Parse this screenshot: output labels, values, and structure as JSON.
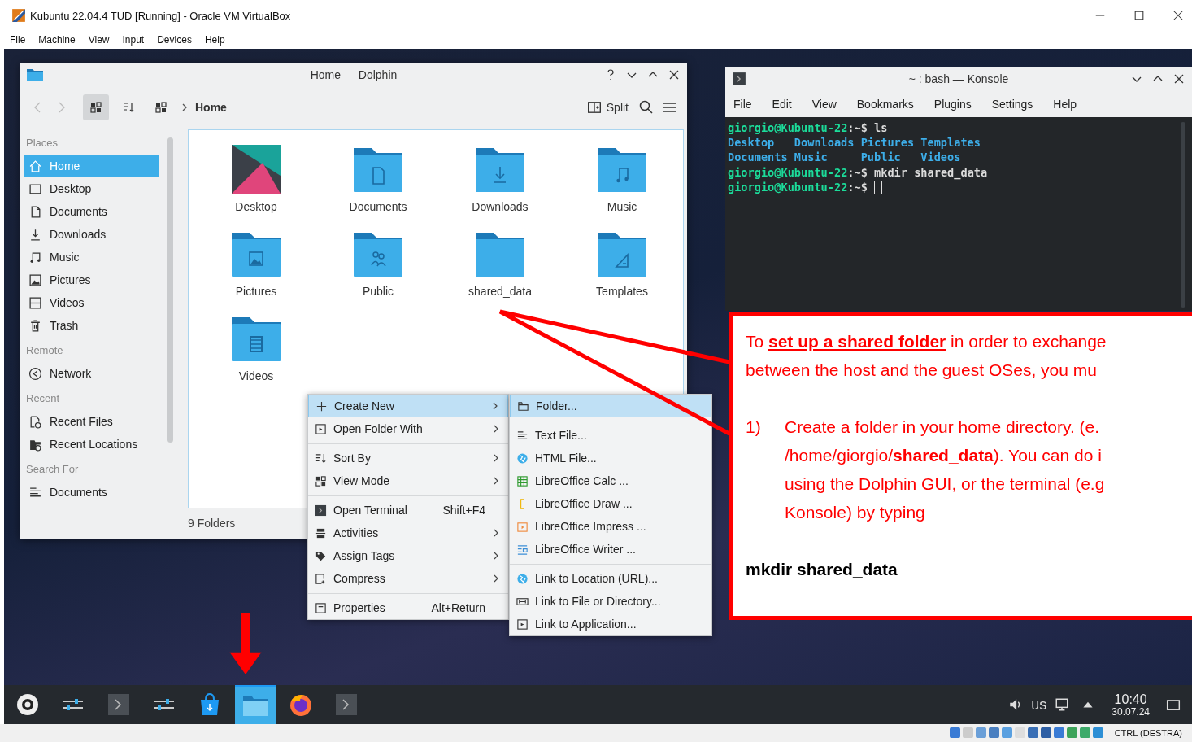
{
  "vbox": {
    "title": "Kubuntu 22.04.4 TUD [Running] - Oracle VM VirtualBox",
    "menu": [
      "File",
      "Machine",
      "View",
      "Input",
      "Devices",
      "Help"
    ]
  },
  "dolphin": {
    "title": "Home — Dolphin",
    "view_modes": [
      {
        "selected": true
      },
      {
        "selected": false
      },
      {
        "selected": false
      }
    ],
    "breadcrumb": "Home",
    "split_label": "Split",
    "places": [
      {
        "heading": "Places",
        "items": [
          {
            "label": "Home",
            "selected": true
          },
          {
            "label": "Desktop",
            "selected": false
          },
          {
            "label": "Documents",
            "selected": false
          },
          {
            "label": "Downloads",
            "selected": false
          },
          {
            "label": "Music",
            "selected": false
          },
          {
            "label": "Pictures",
            "selected": false
          },
          {
            "label": "Videos",
            "selected": false
          },
          {
            "label": "Trash",
            "selected": false
          }
        ]
      },
      {
        "heading": "Remote",
        "items": [
          {
            "label": "Network",
            "selected": false
          }
        ]
      },
      {
        "heading": "Recent",
        "items": [
          {
            "label": "Recent Files",
            "selected": false
          },
          {
            "label": "Recent Locations",
            "selected": false
          }
        ]
      },
      {
        "heading": "Search For",
        "items": [
          {
            "label": "Documents",
            "selected": false
          }
        ]
      }
    ],
    "files": [
      {
        "name": "Desktop",
        "kind": "desktop"
      },
      {
        "name": "Documents",
        "kind": "documents"
      },
      {
        "name": "Downloads",
        "kind": "downloads"
      },
      {
        "name": "Music",
        "kind": "music"
      },
      {
        "name": "Pictures",
        "kind": "pictures"
      },
      {
        "name": "Public",
        "kind": "public"
      },
      {
        "name": "shared_data",
        "kind": "plain"
      },
      {
        "name": "Templates",
        "kind": "templates"
      },
      {
        "name": "Videos",
        "kind": "videos"
      }
    ],
    "status": "9 Folders"
  },
  "context_menu": {
    "items": [
      {
        "kind": "item",
        "label": "Create New",
        "submenu": true,
        "selected": true
      },
      {
        "kind": "item",
        "label": "Open Folder With",
        "submenu": true,
        "selected": false
      },
      {
        "kind": "separator"
      },
      {
        "kind": "item",
        "label": "Sort By",
        "submenu": true,
        "selected": false
      },
      {
        "kind": "item",
        "label": "View Mode",
        "submenu": true,
        "selected": false
      },
      {
        "kind": "separator"
      },
      {
        "kind": "item",
        "label": "Open Terminal",
        "shortcut": "Shift+F4",
        "submenu": false,
        "selected": false
      },
      {
        "kind": "item",
        "label": "Activities",
        "submenu": true,
        "selected": false
      },
      {
        "kind": "item",
        "label": "Assign Tags",
        "submenu": true,
        "selected": false
      },
      {
        "kind": "item",
        "label": "Compress",
        "submenu": true,
        "selected": false
      },
      {
        "kind": "separator"
      },
      {
        "kind": "item",
        "label": "Properties",
        "shortcut": "Alt+Return",
        "submenu": false,
        "selected": false
      }
    ]
  },
  "submenu": {
    "items": [
      {
        "kind": "item",
        "label": "Folder...",
        "selected": true
      },
      {
        "kind": "separator"
      },
      {
        "kind": "item",
        "label": "Text File...",
        "selected": false
      },
      {
        "kind": "item",
        "label": "HTML File...",
        "selected": false
      },
      {
        "kind": "item",
        "label": "LibreOffice Calc ...",
        "selected": false
      },
      {
        "kind": "item",
        "label": "LibreOffice Draw ...",
        "selected": false
      },
      {
        "kind": "item",
        "label": "LibreOffice Impress ...",
        "selected": false
      },
      {
        "kind": "item",
        "label": "LibreOffice Writer ...",
        "selected": false
      },
      {
        "kind": "separator"
      },
      {
        "kind": "item",
        "label": "Link to Location (URL)...",
        "selected": false
      },
      {
        "kind": "item",
        "label": "Link to File or Directory...",
        "selected": false
      },
      {
        "kind": "item",
        "label": "Link to Application...",
        "selected": false
      }
    ]
  },
  "konsole": {
    "title": "~ : bash — Konsole",
    "menu": [
      "File",
      "Edit",
      "View",
      "Bookmarks",
      "Plugins",
      "Settings",
      "Help"
    ],
    "lines": [
      {
        "kind": "prompt",
        "user_host": "giorgio@Kubuntu-22",
        "path": ":~$",
        "command": "ls",
        "cursor": false
      },
      {
        "kind": "listing",
        "entries": [
          "Desktop",
          "Downloads",
          "Pictures",
          "Templates"
        ]
      },
      {
        "kind": "listing",
        "entries": [
          "Documents",
          "Music",
          "Public",
          "Videos"
        ]
      },
      {
        "kind": "prompt",
        "user_host": "giorgio@Kubuntu-22",
        "path": ":~$",
        "command": "mkdir shared_data",
        "cursor": false
      },
      {
        "kind": "prompt",
        "user_host": "giorgio@Kubuntu-22",
        "path": ":~$",
        "cursor": true
      }
    ]
  },
  "callout": {
    "intro": [
      "To **set up a shared folder** in order to exchange",
      "between the host and the guest OSes, you mu"
    ],
    "step_number": "1)",
    "step_lines": [
      "Create a folder in your home directory. (e.",
      "/home/giorgio/**shared_data**). You can do i",
      "using the Dolphin GUI, or the terminal (e.g",
      "Konsole) by typing"
    ],
    "command": "mkdir shared_data"
  },
  "taskbar": {
    "tasks": [
      {
        "kind": "launcher",
        "selected": false
      },
      {
        "kind": "sliders",
        "selected": false
      },
      {
        "kind": "terminal",
        "selected": false
      },
      {
        "kind": "sliders",
        "selected": false
      },
      {
        "kind": "store",
        "selected": false
      },
      {
        "kind": "files",
        "selected": true
      },
      {
        "kind": "browser",
        "selected": false
      },
      {
        "kind": "terminal",
        "selected": false
      }
    ],
    "layout": "us",
    "time": "10:40",
    "date": "30.07.24"
  },
  "vbox_status": {
    "host_key": "CTRL (DESTRA)"
  }
}
